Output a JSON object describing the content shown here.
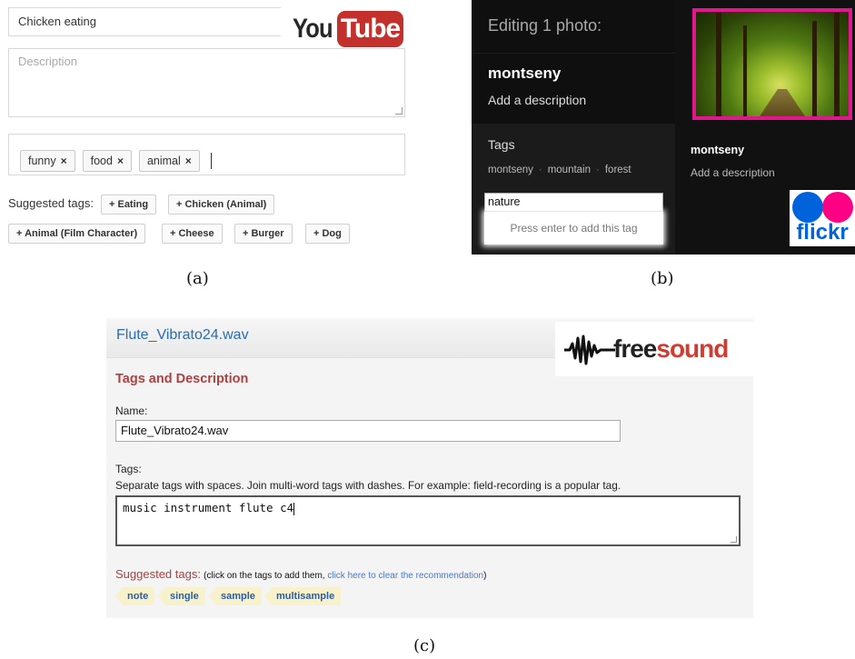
{
  "youtube": {
    "title_value": "Chicken eating",
    "logo_you": "You",
    "logo_tube": "Tube",
    "description_placeholder": "Description",
    "tags": [
      "funny",
      "food",
      "animal"
    ],
    "remove_symbol": "×",
    "suggested_label": "Suggested tags:",
    "suggested": [
      "+ Eating",
      "+ Chicken (Animal)",
      "+ Animal (Film Character)",
      "+ Cheese",
      "+ Burger",
      "+ Dog"
    ]
  },
  "flickr": {
    "editing_label": "Editing 1 photo:",
    "photo_name": "montseny",
    "add_description": "Add a description",
    "tags_label": "Tags",
    "tags": [
      "montseny",
      "mountain",
      "forest"
    ],
    "tag_separator": "·",
    "tag_input_value": "nature",
    "tag_hint": "Press enter to add this tag",
    "right_name": "montseny",
    "right_description": "Add a description",
    "logo_text": "flickr",
    "accent_color": "#e3168d"
  },
  "freesound": {
    "filename": "Flute_Vibrato24.wav",
    "logo_free": "free",
    "logo_sound": "sound",
    "section_title": "Tags and Description",
    "name_label": "Name:",
    "name_value": "Flute_Vibrato24.wav",
    "tags_label": "Tags:",
    "tags_help": "Separate tags with spaces. Join multi-word tags with dashes. For example: field-recording is a popular tag.",
    "tags_value": "music instrument flute c4",
    "suggested_label": "Suggested tags:",
    "suggested_note_open": "(click on the tags to add them, ",
    "suggested_clear_link": "click here to clear the recommendation",
    "suggested_note_close": ")",
    "suggested": [
      "note",
      "single",
      "sample",
      "multisample"
    ]
  },
  "captions": {
    "a": "(a)",
    "b": "(b)",
    "c": "(c)"
  }
}
